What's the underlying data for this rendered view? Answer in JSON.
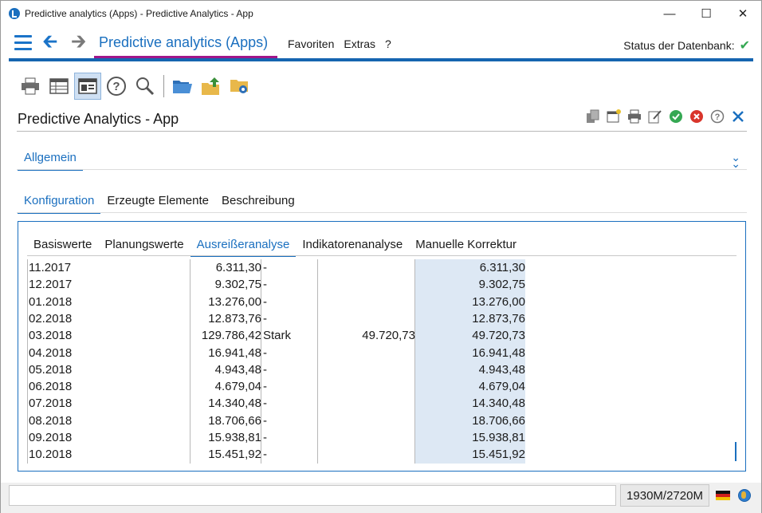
{
  "window": {
    "title": "Predictive analytics (Apps) - Predictive Analytics - App",
    "controls": {
      "minimize": "—",
      "maximize": "☐",
      "close": "✕"
    }
  },
  "menubar": {
    "app_title": "Predictive analytics (Apps)",
    "items": [
      "Favoriten",
      "Extras",
      "?"
    ],
    "status_label": "Status der Datenbank:",
    "status_icon": "check-icon",
    "accent_color": "#1565b0"
  },
  "toolbar": {
    "icons": [
      "print-icon",
      "table-view-icon",
      "form-view-icon",
      "help-icon",
      "search-icon",
      "open-folder-icon",
      "upload-folder-icon",
      "folder-settings-icon"
    ]
  },
  "page": {
    "title": "Predictive Analytics - App",
    "actions": [
      "copy-icon",
      "new-icon",
      "print-icon",
      "edit-icon",
      "confirm-icon",
      "cancel-icon",
      "help-icon",
      "close-icon"
    ]
  },
  "section": {
    "label": "Allgemein"
  },
  "main_tabs": [
    {
      "label": "Konfiguration",
      "active": true
    },
    {
      "label": "Erzeugte Elemente",
      "active": false
    },
    {
      "label": "Beschreibung",
      "active": false
    }
  ],
  "sub_tabs": [
    {
      "label": "Basiswerte",
      "active": false
    },
    {
      "label": "Planungswerte",
      "active": false
    },
    {
      "label": "Ausreißeranalyse",
      "active": true
    },
    {
      "label": "Indikatorenanalyse",
      "active": false
    },
    {
      "label": "Manuelle Korrektur",
      "active": false
    }
  ],
  "grid": {
    "rows": [
      {
        "period": "11.2017",
        "value": "6.311,30",
        "classification": "-",
        "indicator": "",
        "corrected": "6.311,30"
      },
      {
        "period": "12.2017",
        "value": "9.302,75",
        "classification": "-",
        "indicator": "",
        "corrected": "9.302,75"
      },
      {
        "period": "01.2018",
        "value": "13.276,00",
        "classification": "-",
        "indicator": "",
        "corrected": "13.276,00"
      },
      {
        "period": "02.2018",
        "value": "12.873,76",
        "classification": "-",
        "indicator": "",
        "corrected": "12.873,76"
      },
      {
        "period": "03.2018",
        "value": "129.786,42",
        "classification": "Stark",
        "indicator": "49.720,73",
        "corrected": "49.720,73"
      },
      {
        "period": "04.2018",
        "value": "16.941,48",
        "classification": "-",
        "indicator": "",
        "corrected": "16.941,48"
      },
      {
        "period": "05.2018",
        "value": "4.943,48",
        "classification": "-",
        "indicator": "",
        "corrected": "4.943,48"
      },
      {
        "period": "06.2018",
        "value": "4.679,04",
        "classification": "-",
        "indicator": "",
        "corrected": "4.679,04"
      },
      {
        "period": "07.2018",
        "value": "14.340,48",
        "classification": "-",
        "indicator": "",
        "corrected": "14.340,48"
      },
      {
        "period": "08.2018",
        "value": "18.706,66",
        "classification": "-",
        "indicator": "",
        "corrected": "18.706,66"
      },
      {
        "period": "09.2018",
        "value": "15.938,81",
        "classification": "-",
        "indicator": "",
        "corrected": "15.938,81"
      },
      {
        "period": "10.2018",
        "value": "15.451,92",
        "classification": "-",
        "indicator": "",
        "corrected": "15.451,92"
      }
    ]
  },
  "statusbar": {
    "message": "",
    "memory": "1930M/2720M",
    "language_flag": "german-flag-icon",
    "globe_icon": "globe-icon"
  }
}
